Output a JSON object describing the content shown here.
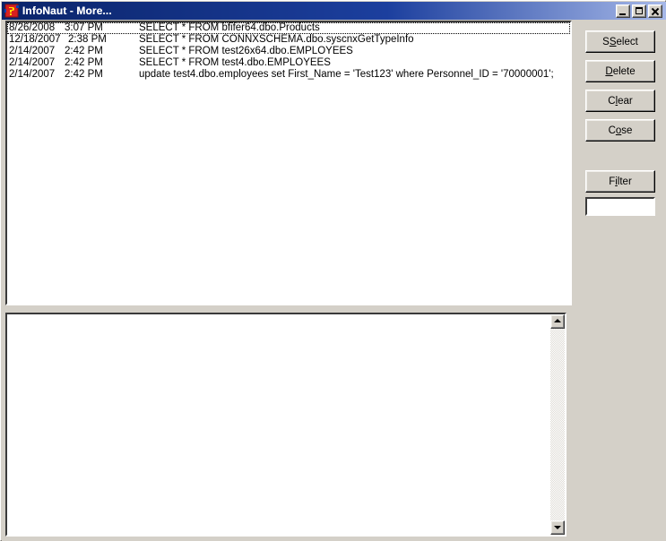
{
  "window": {
    "title": "InfoNaut  - More...",
    "icon": "infonaut-app-icon",
    "controls": {
      "minimize": "minimize-icon",
      "maximize": "maximize-icon",
      "close": "close-icon"
    },
    "colors": {
      "titlebar_start": "#0a246a",
      "titlebar_end": "#a6b8e8",
      "face": "#d4d0c8",
      "field": "#ffffff",
      "text": "#000000"
    }
  },
  "log_list": {
    "rows": [
      {
        "date": "8/26/2008",
        "time": "3:07 PM",
        "query": "SELECT * FROM bfifer64.dbo.Products",
        "focused": true
      },
      {
        "date": "12/18/2007",
        "time": "2:38 PM",
        "query": "SELECT * FROM CONNXSCHEMA.dbo.syscnxGetTypeInfo",
        "focused": false
      },
      {
        "date": "2/14/2007",
        "time": "2:42 PM",
        "query": "SELECT * FROM test26x64.dbo.EMPLOYEES",
        "focused": false
      },
      {
        "date": "2/14/2007",
        "time": "2:42 PM",
        "query": "SELECT * FROM test4.dbo.EMPLOYEES",
        "focused": false
      },
      {
        "date": "2/14/2007",
        "time": "2:42 PM",
        "query": "update test4.dbo.employees set First_Name = 'Test123' where Personnel_ID = '70000001';",
        "focused": false
      }
    ]
  },
  "detail_panel": {
    "text": "",
    "scrollbar": {
      "up_icon": "scroll-up-arrow-icon",
      "down_icon": "scroll-down-arrow-icon"
    }
  },
  "buttons": {
    "select": {
      "pre": "S",
      "acc": "",
      "post": "elect",
      "label": "Select",
      "accel": "S"
    },
    "delete": {
      "pre": "",
      "acc": "D",
      "post": "elete",
      "label": "Delete",
      "accel": "D"
    },
    "clear": {
      "pre": "C",
      "acc": "l",
      "post": "ear",
      "label": "Clear",
      "accel": "l"
    },
    "close": {
      "pre": "C",
      "acc": "o",
      "post": "se",
      "label": "Close",
      "accel": "o"
    },
    "filter": {
      "pre": "F",
      "acc": "i",
      "post": "lter",
      "label": "Filter",
      "accel": "i"
    }
  },
  "filter_input": {
    "value": "",
    "placeholder": ""
  }
}
